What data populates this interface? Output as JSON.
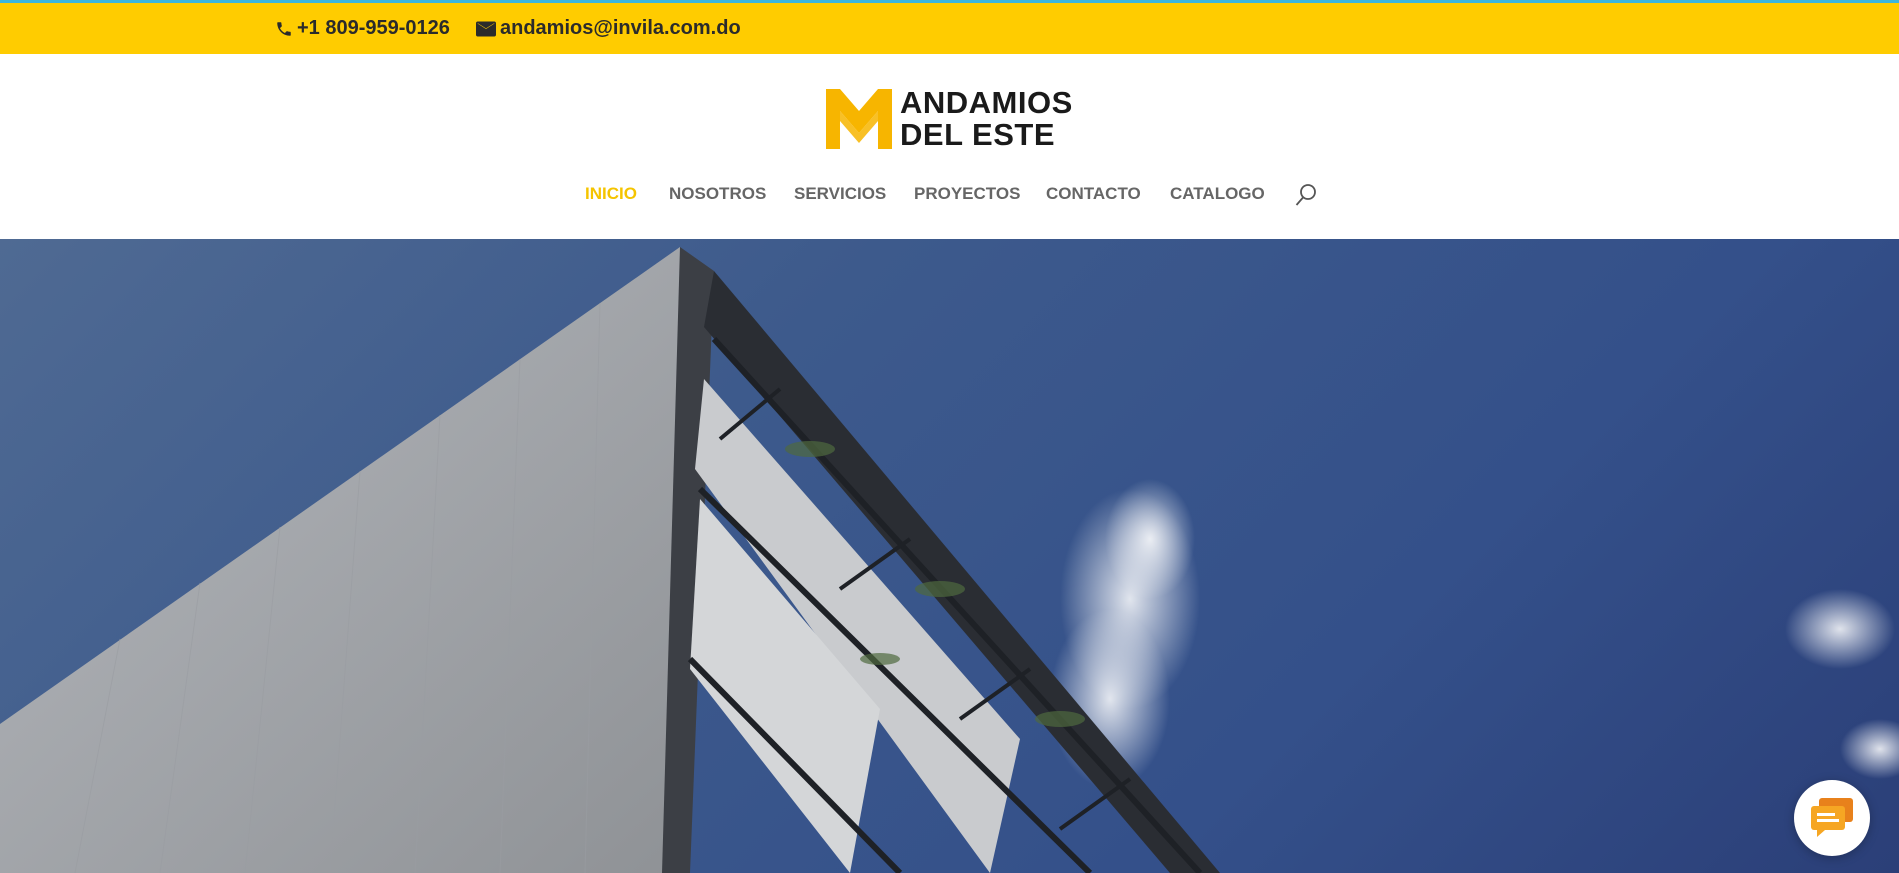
{
  "topbar": {
    "phone": "+1 809-959-0126",
    "email": "andamios@invila.com.do"
  },
  "logo": {
    "line1": "ANDAMIOS",
    "line2": "DEL ESTE"
  },
  "nav": {
    "items": [
      {
        "label": "INICIO",
        "active": true
      },
      {
        "label": "NOSOTROS",
        "active": false
      },
      {
        "label": "SERVICIOS",
        "active": false
      },
      {
        "label": "PROYECTOS",
        "active": false
      },
      {
        "label": "CONTACTO",
        "active": false
      },
      {
        "label": "CATALOGO",
        "active": false
      }
    ]
  },
  "icons": [
    "phone-icon",
    "mail-icon",
    "search-icon",
    "chat-icon"
  ],
  "colors": {
    "topbar_bg": "#ffcc00",
    "accent_line": "#3bb6e0",
    "nav_active": "#f5c400",
    "nav_default": "#666666",
    "sky": "#34508a"
  }
}
